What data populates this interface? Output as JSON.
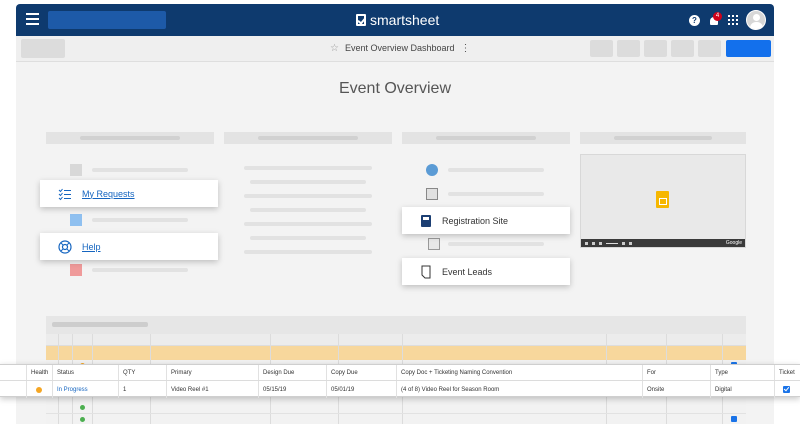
{
  "app": {
    "brand": "smartsheet",
    "notifications_count": "4"
  },
  "toolbar": {
    "title": "Event Overview Dashboard"
  },
  "dashboard": {
    "title": "Event Overview",
    "left_links": [
      {
        "label": "My Requests",
        "icon": "list-check-icon"
      },
      {
        "label": "Help",
        "icon": "lifebuoy-icon"
      }
    ],
    "right_links": [
      {
        "label": "Registration Site",
        "icon": "notebook-icon"
      },
      {
        "label": "Event Leads",
        "icon": "document-icon"
      }
    ],
    "video_watermark": "Google"
  },
  "sheet": {
    "headers": [
      "Health",
      "Status",
      "QTY",
      "Primary",
      "Design Due",
      "Copy Due",
      "Copy Doc + Ticketing Naming Convention",
      "For",
      "Type",
      "Ticket"
    ],
    "row": {
      "health": "yellow",
      "status": "In Progress",
      "qty": "1",
      "primary": "Video Reel #1",
      "design_due": "05/15/19",
      "copy_due": "05/01/19",
      "copy_doc": "(4 of 8) Video Reel for Season Room",
      "for": "Onsite",
      "type": "Digital",
      "ticket": true
    }
  },
  "colors": {
    "topbar": "#0e3a6e",
    "accent": "#1370ec",
    "link": "#1565c0",
    "health_yellow": "#f5a623",
    "health_green": "#4caf50",
    "banner_orange": "#f7d79c"
  }
}
